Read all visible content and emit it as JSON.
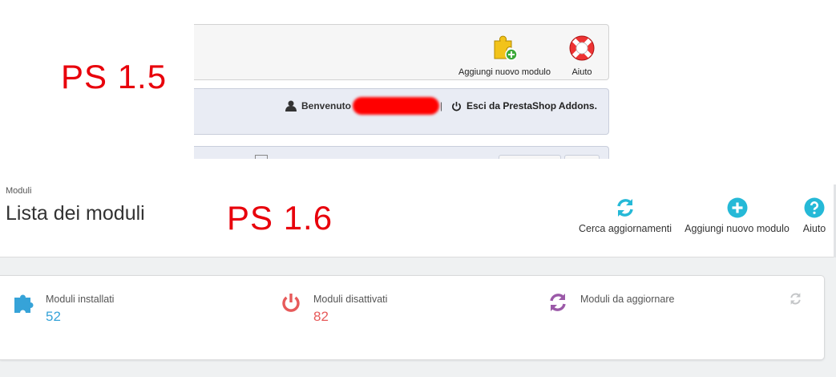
{
  "labels": {
    "old_version": "PS 1.5",
    "new_version": "PS 1.6"
  },
  "old_ui": {
    "toolbar": {
      "add_module": "Aggiungi nuovo modulo",
      "help": "Aiuto"
    },
    "welcome": {
      "greeting": "Benvenuto",
      "separator": "|",
      "logout": "Esci da PrestaShop Addons."
    }
  },
  "new_ui": {
    "breadcrumb": "Moduli",
    "title": "Lista dei moduli",
    "toolbar": {
      "check_updates": "Cerca aggiornamenti",
      "add_module": "Aggiungi nuovo modulo",
      "help": "Aiuto"
    },
    "kpis": [
      {
        "label": "Moduli installati",
        "value": "52",
        "color": "#36a3d8",
        "icon": "puzzle-icon"
      },
      {
        "label": "Moduli disattivati",
        "value": "82",
        "color": "#e75a5a",
        "icon": "power-icon"
      },
      {
        "label": "Moduli da aggiornare",
        "value": "",
        "color": "#9b59a8",
        "icon": "refresh-icon"
      }
    ]
  },
  "colors": {
    "accent_blue": "#25b9d7",
    "label_red": "#e8000b"
  }
}
